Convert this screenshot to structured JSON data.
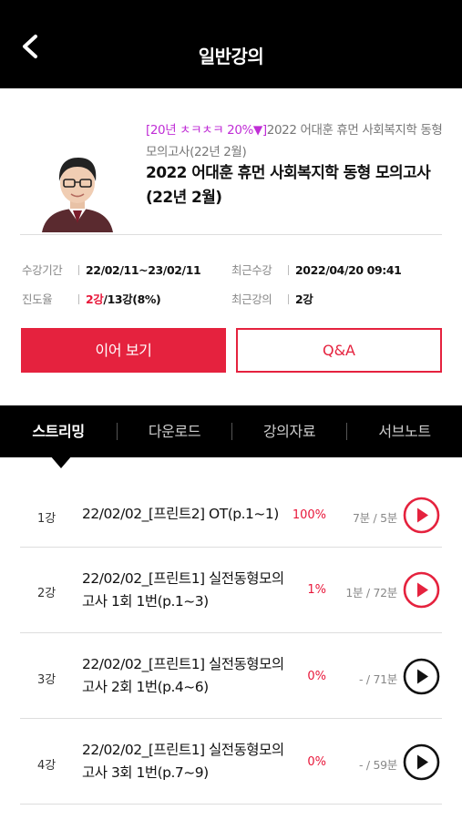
{
  "header": {
    "title": "일반강의"
  },
  "course": {
    "promo": "[20년 ㅊㅋㅊㅋ 20%▼]",
    "subtitle_rest": "2022 어대훈 휴먼 사회복지학 동형 모의고사(22년 2월)",
    "title": "2022 어대훈 휴먼 사회복지학 동형 모의고사(22년 2월)"
  },
  "meta": {
    "period_label": "수강기간",
    "period_value": "22/02/11~23/02/11",
    "recent_label": "최근수강",
    "recent_value": "2022/04/20 09:41",
    "progress_label": "진도율",
    "progress_done": "2강",
    "progress_rest": "/13강(8%)",
    "last_lecture_label": "최근강의",
    "last_lecture_value": "2강"
  },
  "buttons": {
    "continue": "이어 보기",
    "qa": "Q&A"
  },
  "tabs": [
    "스트리밍",
    "다운로드",
    "강의자료",
    "서브노트"
  ],
  "lectures": [
    {
      "num": "1강",
      "title": "22/02/02_[프린트2] OT(p.1~1)",
      "pct": "100%",
      "time": "7분 / 5분",
      "status": "watched",
      "progress": 1.0
    },
    {
      "num": "2강",
      "title": "22/02/02_[프린트1] 실전동형모의고사 1회 1번(p.1~3)",
      "pct": "1%",
      "time": "1분 / 72분",
      "status": "watched",
      "progress": 0.01
    },
    {
      "num": "3강",
      "title": "22/02/02_[프린트1] 실전동형모의고사 2회 1번(p.4~6)",
      "pct": "0%",
      "time": "- / 71분",
      "status": "unwatched",
      "progress": 0
    },
    {
      "num": "4강",
      "title": "22/02/02_[프린트1] 실전동형모의고사 3회 1번(p.7~9)",
      "pct": "0%",
      "time": "- / 59분",
      "status": "unwatched",
      "progress": 0
    }
  ],
  "colors": {
    "accent": "#e5223e",
    "header_bg": "#000000",
    "promo": "#c02ed6"
  }
}
